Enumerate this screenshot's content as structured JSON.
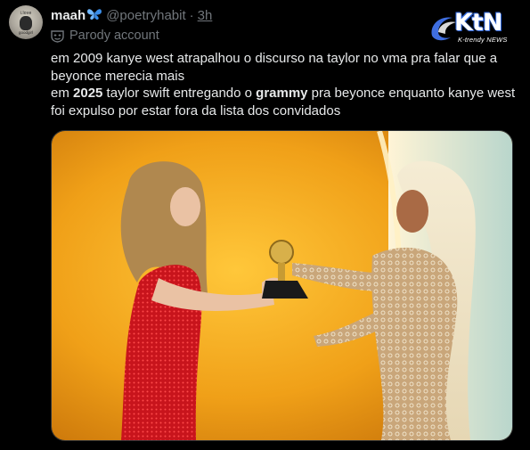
{
  "author": {
    "display_name": "maah",
    "handle": "@poetryhabit",
    "separator": "·",
    "time": "3h",
    "label": "Parody account",
    "avatar_caption_top": "i.love",
    "avatar_caption_bottom": "goodgirl",
    "name_emoji_icon": "blue-butterfly-icon",
    "label_icon": "mask-icon"
  },
  "watermark": {
    "main": "KtN",
    "sub": "K-trendy NEWS"
  },
  "tweet": {
    "line1": "em 2009 kanye west atrapalhou o discurso na taylor no vma pra falar que a beyonce merecia mais",
    "line2_prefix": "em ",
    "line2_year": "2025",
    "line2_middle": " taylor swift entregando o ",
    "line2_award": "grammy",
    "line2_suffix": " pra beyonce enquanto kanye west foi expulso por estar fora da lista dos convidados"
  },
  "colors": {
    "background": "#000000",
    "text": "#e7e9ea",
    "muted": "#71767b",
    "accent_blue": "#1d9bf0",
    "stage_orange": "#f0a018",
    "red_dress": "#c8141c",
    "gold_dress": "#c9a67a"
  }
}
